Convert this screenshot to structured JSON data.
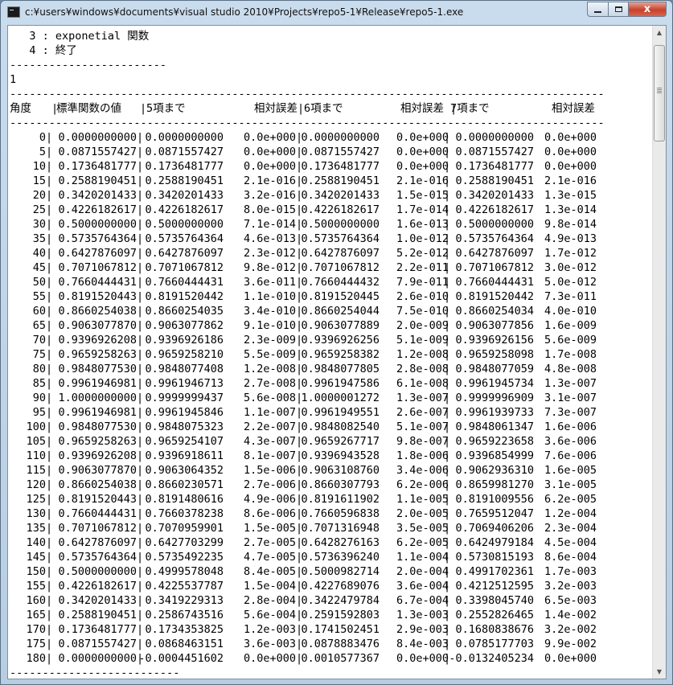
{
  "window": {
    "title": "c:¥users¥windows¥documents¥visual studio 2010¥Projects¥repo5-1¥Release¥repo5-1.exe",
    "min_label": "",
    "max_label": "",
    "close_label": "x"
  },
  "console": {
    "top_lines": [
      "   3 : exponetial 関数",
      "   4 : 終了",
      "------------------------",
      "1",
      "-------------------------------------------------------------------------------------------"
    ],
    "header": [
      "角度",
      "標準関数の値",
      "5項まで",
      "相対誤差",
      "6項まで",
      "相対誤差",
      "7項まで",
      "相対誤差"
    ],
    "separator": "-------------------------------------------------------------------------------------------",
    "rows": [
      [
        "0",
        "0.0000000000",
        "0.0000000000",
        "0.0e+000",
        "0.0000000000",
        "0.0e+000",
        "0.0000000000",
        "0.0e+000"
      ],
      [
        "5",
        "0.0871557427",
        "0.0871557427",
        "0.0e+000",
        "0.0871557427",
        "0.0e+000",
        "0.0871557427",
        "0.0e+000"
      ],
      [
        "10",
        "0.1736481777",
        "0.1736481777",
        "0.0e+000",
        "0.1736481777",
        "0.0e+000",
        "0.1736481777",
        "0.0e+000"
      ],
      [
        "15",
        "0.2588190451",
        "0.2588190451",
        "2.1e-016",
        "0.2588190451",
        "2.1e-016",
        "0.2588190451",
        "2.1e-016"
      ],
      [
        "20",
        "0.3420201433",
        "0.3420201433",
        "3.2e-016",
        "0.3420201433",
        "1.5e-015",
        "0.3420201433",
        "1.3e-015"
      ],
      [
        "25",
        "0.4226182617",
        "0.4226182617",
        "8.0e-015",
        "0.4226182617",
        "1.7e-014",
        "0.4226182617",
        "1.3e-014"
      ],
      [
        "30",
        "0.5000000000",
        "0.5000000000",
        "7.1e-014",
        "0.5000000000",
        "1.6e-013",
        "0.5000000000",
        "9.8e-014"
      ],
      [
        "35",
        "0.5735764364",
        "0.5735764364",
        "4.6e-013",
        "0.5735764364",
        "1.0e-012",
        "0.5735764364",
        "4.9e-013"
      ],
      [
        "40",
        "0.6427876097",
        "0.6427876097",
        "2.3e-012",
        "0.6427876097",
        "5.2e-012",
        "0.6427876097",
        "1.7e-012"
      ],
      [
        "45",
        "0.7071067812",
        "0.7071067812",
        "9.8e-012",
        "0.7071067812",
        "2.2e-011",
        "0.7071067812",
        "3.0e-012"
      ],
      [
        "50",
        "0.7660444431",
        "0.7660444431",
        "3.6e-011",
        "0.7660444432",
        "7.9e-011",
        "0.7660444431",
        "5.0e-012"
      ],
      [
        "55",
        "0.8191520443",
        "0.8191520442",
        "1.1e-010",
        "0.8191520445",
        "2.6e-010",
        "0.8191520442",
        "7.3e-011"
      ],
      [
        "60",
        "0.8660254038",
        "0.8660254035",
        "3.4e-010",
        "0.8660254044",
        "7.5e-010",
        "0.8660254034",
        "4.0e-010"
      ],
      [
        "65",
        "0.9063077870",
        "0.9063077862",
        "9.1e-010",
        "0.9063077889",
        "2.0e-009",
        "0.9063077856",
        "1.6e-009"
      ],
      [
        "70",
        "0.9396926208",
        "0.9396926186",
        "2.3e-009",
        "0.9396926256",
        "5.1e-009",
        "0.9396926156",
        "5.6e-009"
      ],
      [
        "75",
        "0.9659258263",
        "0.9659258210",
        "5.5e-009",
        "0.9659258382",
        "1.2e-008",
        "0.9659258098",
        "1.7e-008"
      ],
      [
        "80",
        "0.9848077530",
        "0.9848077408",
        "1.2e-008",
        "0.9848077805",
        "2.8e-008",
        "0.9848077059",
        "4.8e-008"
      ],
      [
        "85",
        "0.9961946981",
        "0.9961946713",
        "2.7e-008",
        "0.9961947586",
        "6.1e-008",
        "0.9961945734",
        "1.3e-007"
      ],
      [
        "90",
        "1.0000000000",
        "0.9999999437",
        "5.6e-008",
        "1.0000001272",
        "1.3e-007",
        "0.9999996909",
        "3.1e-007"
      ],
      [
        "95",
        "0.9961946981",
        "0.9961945846",
        "1.1e-007",
        "0.9961949551",
        "2.6e-007",
        "0.9961939733",
        "7.3e-007"
      ],
      [
        "100",
        "0.9848077530",
        "0.9848075323",
        "2.2e-007",
        "0.9848082540",
        "5.1e-007",
        "0.9848061347",
        "1.6e-006"
      ],
      [
        "105",
        "0.9659258263",
        "0.9659254107",
        "4.3e-007",
        "0.9659267717",
        "9.8e-007",
        "0.9659223658",
        "3.6e-006"
      ],
      [
        "110",
        "0.9396926208",
        "0.9396918611",
        "8.1e-007",
        "0.9396943528",
        "1.8e-006",
        "0.9396854999",
        "7.6e-006"
      ],
      [
        "115",
        "0.9063077870",
        "0.9063064352",
        "1.5e-006",
        "0.9063108760",
        "3.4e-006",
        "0.9062936310",
        "1.6e-005"
      ],
      [
        "120",
        "0.8660254038",
        "0.8660230571",
        "2.7e-006",
        "0.8660307793",
        "6.2e-006",
        "0.8659981270",
        "3.1e-005"
      ],
      [
        "125",
        "0.8191520443",
        "0.8191480616",
        "4.9e-006",
        "0.8191611902",
        "1.1e-005",
        "0.8191009556",
        "6.2e-005"
      ],
      [
        "130",
        "0.7660444431",
        "0.7660378238",
        "8.6e-006",
        "0.7660596838",
        "2.0e-005",
        "0.7659512047",
        "1.2e-004"
      ],
      [
        "135",
        "0.7071067812",
        "0.7070959901",
        "1.5e-005",
        "0.7071316948",
        "3.5e-005",
        "0.7069406206",
        "2.3e-004"
      ],
      [
        "140",
        "0.6427876097",
        "0.6427703299",
        "2.7e-005",
        "0.6428276163",
        "6.2e-005",
        "0.6424979184",
        "4.5e-004"
      ],
      [
        "145",
        "0.5735764364",
        "0.5735492235",
        "4.7e-005",
        "0.5736396240",
        "1.1e-004",
        "0.5730815193",
        "8.6e-004"
      ],
      [
        "150",
        "0.5000000000",
        "0.4999578048",
        "8.4e-005",
        "0.5000982714",
        "2.0e-004",
        "0.4991702361",
        "1.7e-003"
      ],
      [
        "155",
        "0.4226182617",
        "0.4225537787",
        "1.5e-004",
        "0.4227689076",
        "3.6e-004",
        "0.4212512595",
        "3.2e-003"
      ],
      [
        "160",
        "0.3420201433",
        "0.3419229313",
        "2.8e-004",
        "0.3422479784",
        "6.7e-004",
        "0.3398045740",
        "6.5e-003"
      ],
      [
        "165",
        "0.2588190451",
        "0.2586743516",
        "5.6e-004",
        "0.2591592803",
        "1.3e-003",
        "0.2552826465",
        "1.4e-002"
      ],
      [
        "170",
        "0.1736481777",
        "0.1734353825",
        "1.2e-003",
        "0.1741502451",
        "2.9e-003",
        "0.1680838676",
        "3.2e-002"
      ],
      [
        "175",
        "0.0871557427",
        "0.0868463151",
        "3.6e-003",
        "0.0878883476",
        "8.4e-003",
        "0.0785177703",
        "9.9e-002"
      ],
      [
        "180",
        "0.0000000000",
        "-0.0004451602",
        "0.0e+000",
        "0.0010577367",
        "0.0e+000",
        "-0.0132405234",
        "0.0e+000"
      ]
    ],
    "bottom_line": "--------------------------",
    "col_divider": "|"
  },
  "scrollbar": {
    "up_glyph": "▲",
    "down_glyph": "▼"
  }
}
